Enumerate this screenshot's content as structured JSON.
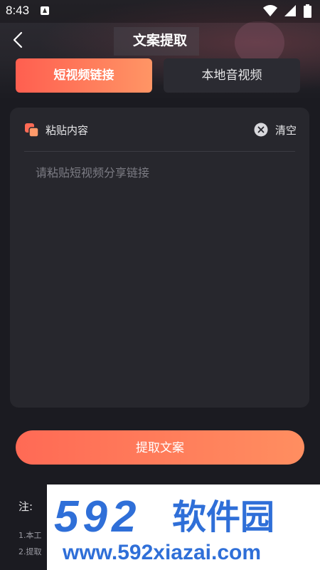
{
  "status_bar": {
    "time": "8:43"
  },
  "header": {
    "title": "文案提取",
    "back_icon": "chevron-left-icon"
  },
  "tabs": [
    {
      "label": "短视频链接",
      "active": true
    },
    {
      "label": "本地音视频",
      "active": false
    }
  ],
  "panel": {
    "paste_label": "粘贴内容",
    "clear_label": "清空",
    "input_value": "",
    "input_placeholder": "请粘贴短视频分享链接"
  },
  "actions": {
    "extract_label": "提取文案"
  },
  "notes": {
    "title": "注:",
    "lines": [
      "1.本工",
      "2.提取"
    ]
  },
  "watermark": {
    "logo_number": "592",
    "logo_text": "软件园",
    "url": "www.592xiazai.com"
  },
  "colors": {
    "accent_start": "#ff5f50",
    "accent_end": "#ff9565",
    "background": "#1b1b21",
    "panel": "#27272d",
    "watermark_blue": "#2f6fd8"
  }
}
